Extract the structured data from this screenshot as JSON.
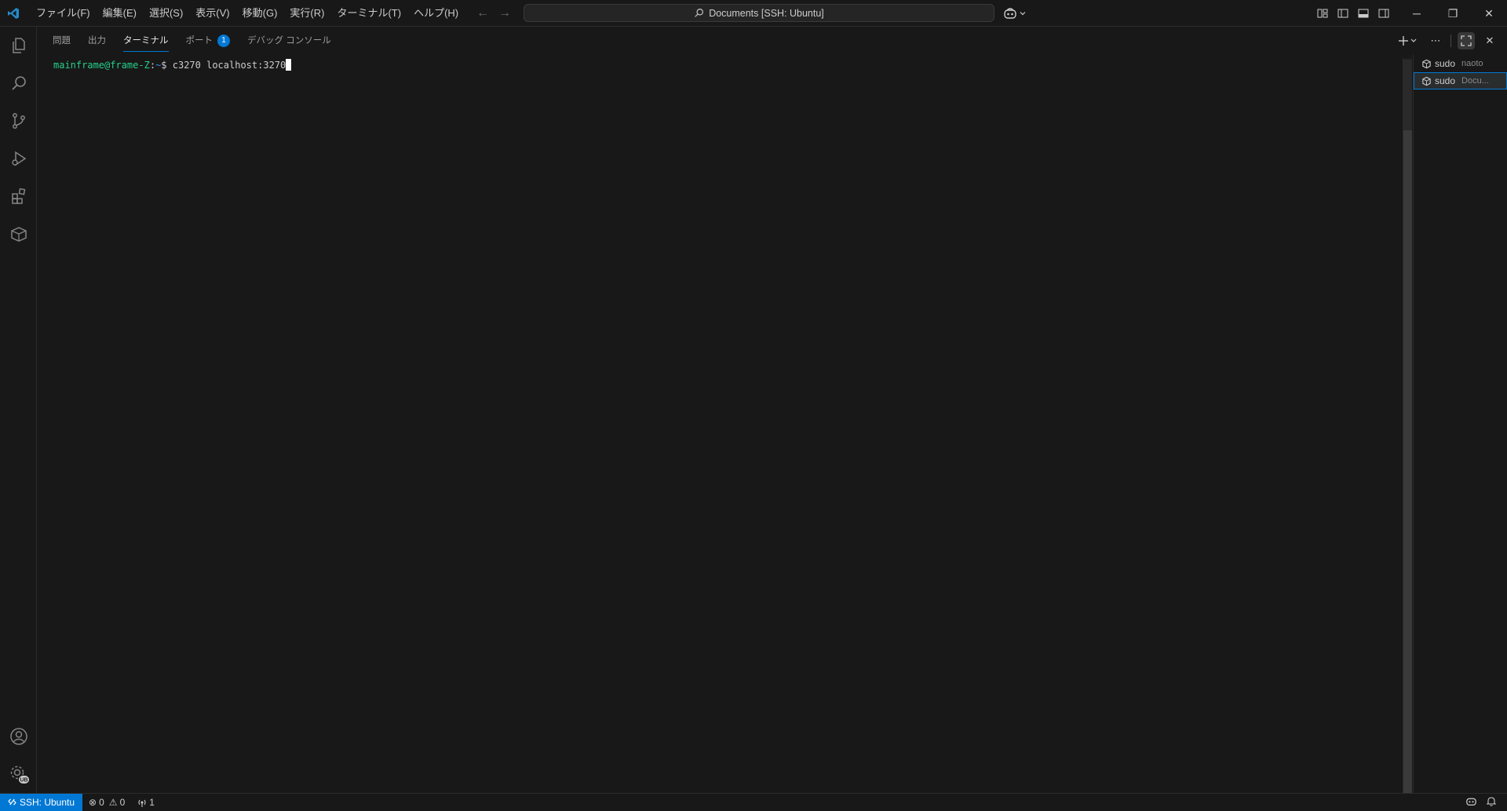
{
  "titlebar": {
    "menus": [
      "ファイル(F)",
      "編集(E)",
      "選択(S)",
      "表示(V)",
      "移動(G)",
      "実行(R)",
      "ターミナル(T)",
      "ヘルプ(H)"
    ],
    "command_center": "Documents [SSH: Ubuntu]"
  },
  "activity_bar": {
    "items": [
      "explorer-icon",
      "search-icon",
      "source-control-icon",
      "run-debug-icon",
      "extensions-icon",
      "remote-explorer-icon"
    ],
    "account_badge": "UB"
  },
  "panel": {
    "tabs": [
      {
        "label": "問題"
      },
      {
        "label": "出力"
      },
      {
        "label": "ターミナル",
        "active": true
      },
      {
        "label": "ポート",
        "badge": "1"
      },
      {
        "label": "デバッグ コンソール"
      }
    ]
  },
  "terminal": {
    "prompt_user": "mainframe@frame-Z",
    "prompt_sep": ":",
    "prompt_path": "~",
    "prompt_symbol": "$ ",
    "command": "c3270 localhost:3270"
  },
  "terminal_list": [
    {
      "name": "sudo",
      "desc": "naoto",
      "active": false
    },
    {
      "name": "sudo",
      "desc": "Docu...",
      "active": true
    }
  ],
  "statusbar": {
    "remote": "SSH: Ubuntu",
    "errors": "0",
    "warnings": "0",
    "ports": "1"
  },
  "colors": {
    "accent": "#0078d4",
    "background": "#181818",
    "prompt_user": "#23d18b",
    "prompt_path": "#3b8eea"
  }
}
